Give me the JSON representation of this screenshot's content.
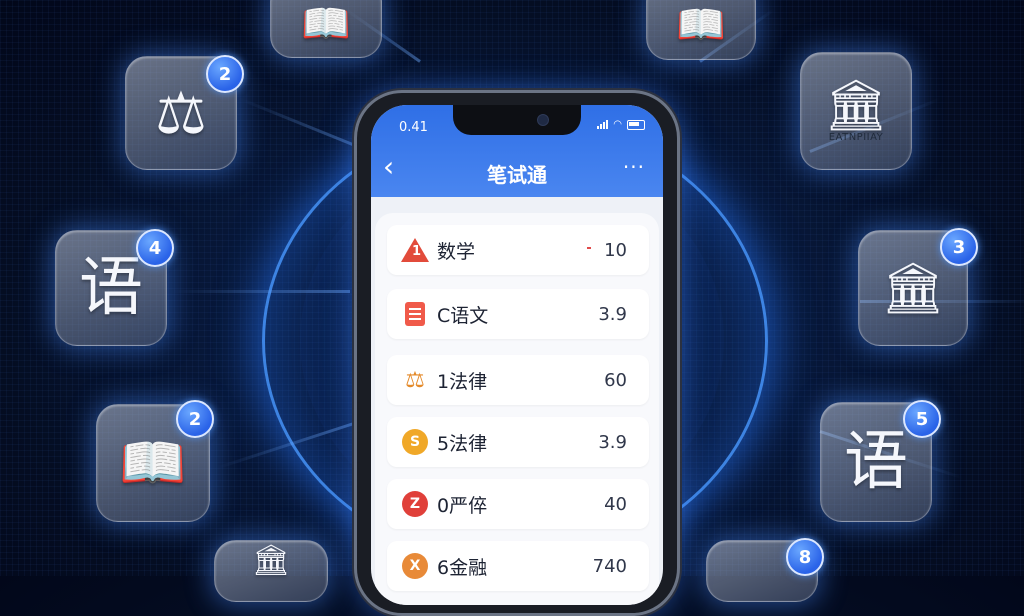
{
  "phone": {
    "status_time": "0.41",
    "app_title": "笔试通",
    "back_glyph": "‹",
    "more_glyph": "···",
    "list": [
      {
        "icon": "warning-icon",
        "icon_text": "1",
        "label": "数学",
        "value": "10"
      },
      {
        "icon": "document-icon",
        "label": "C语文",
        "value": "3.9"
      },
      {
        "icon": "scale-icon",
        "label": "1法律",
        "value": "60"
      },
      {
        "icon": "coin-s-icon",
        "icon_text": "S",
        "label": "5法律",
        "value": "3.9"
      },
      {
        "icon": "coin-z-icon",
        "icon_text": "Z",
        "label": "0严倅",
        "value": "40"
      },
      {
        "icon": "coin-x-icon",
        "icon_text": "X",
        "label": "6金融",
        "value": "740"
      }
    ]
  },
  "tiles": [
    {
      "name": "book-icon",
      "glyph": "📖",
      "badge": ""
    },
    {
      "name": "book-icon",
      "glyph": "📖",
      "badge": ""
    },
    {
      "name": "scale-icon",
      "glyph": "⚖",
      "badge": "2"
    },
    {
      "name": "bank-icon",
      "glyph": "🏛",
      "caption": "EATNPIIAY",
      "badge": ""
    },
    {
      "name": "language-icon",
      "glyph": "语",
      "badge": "4"
    },
    {
      "name": "bank-icon",
      "glyph": "🏛",
      "badge": "3"
    },
    {
      "name": "book-icon",
      "glyph": "📖",
      "badge": "2"
    },
    {
      "name": "language-icon",
      "glyph": "语",
      "badge": "5"
    },
    {
      "name": "bank-icon",
      "glyph": "🏛",
      "badge": ""
    },
    {
      "name": "tile-icon",
      "glyph": "",
      "badge": "8"
    }
  ],
  "colors": {
    "accent": "#2f6fe6",
    "badge": "#2a63e8",
    "glow": "#4696ff"
  }
}
